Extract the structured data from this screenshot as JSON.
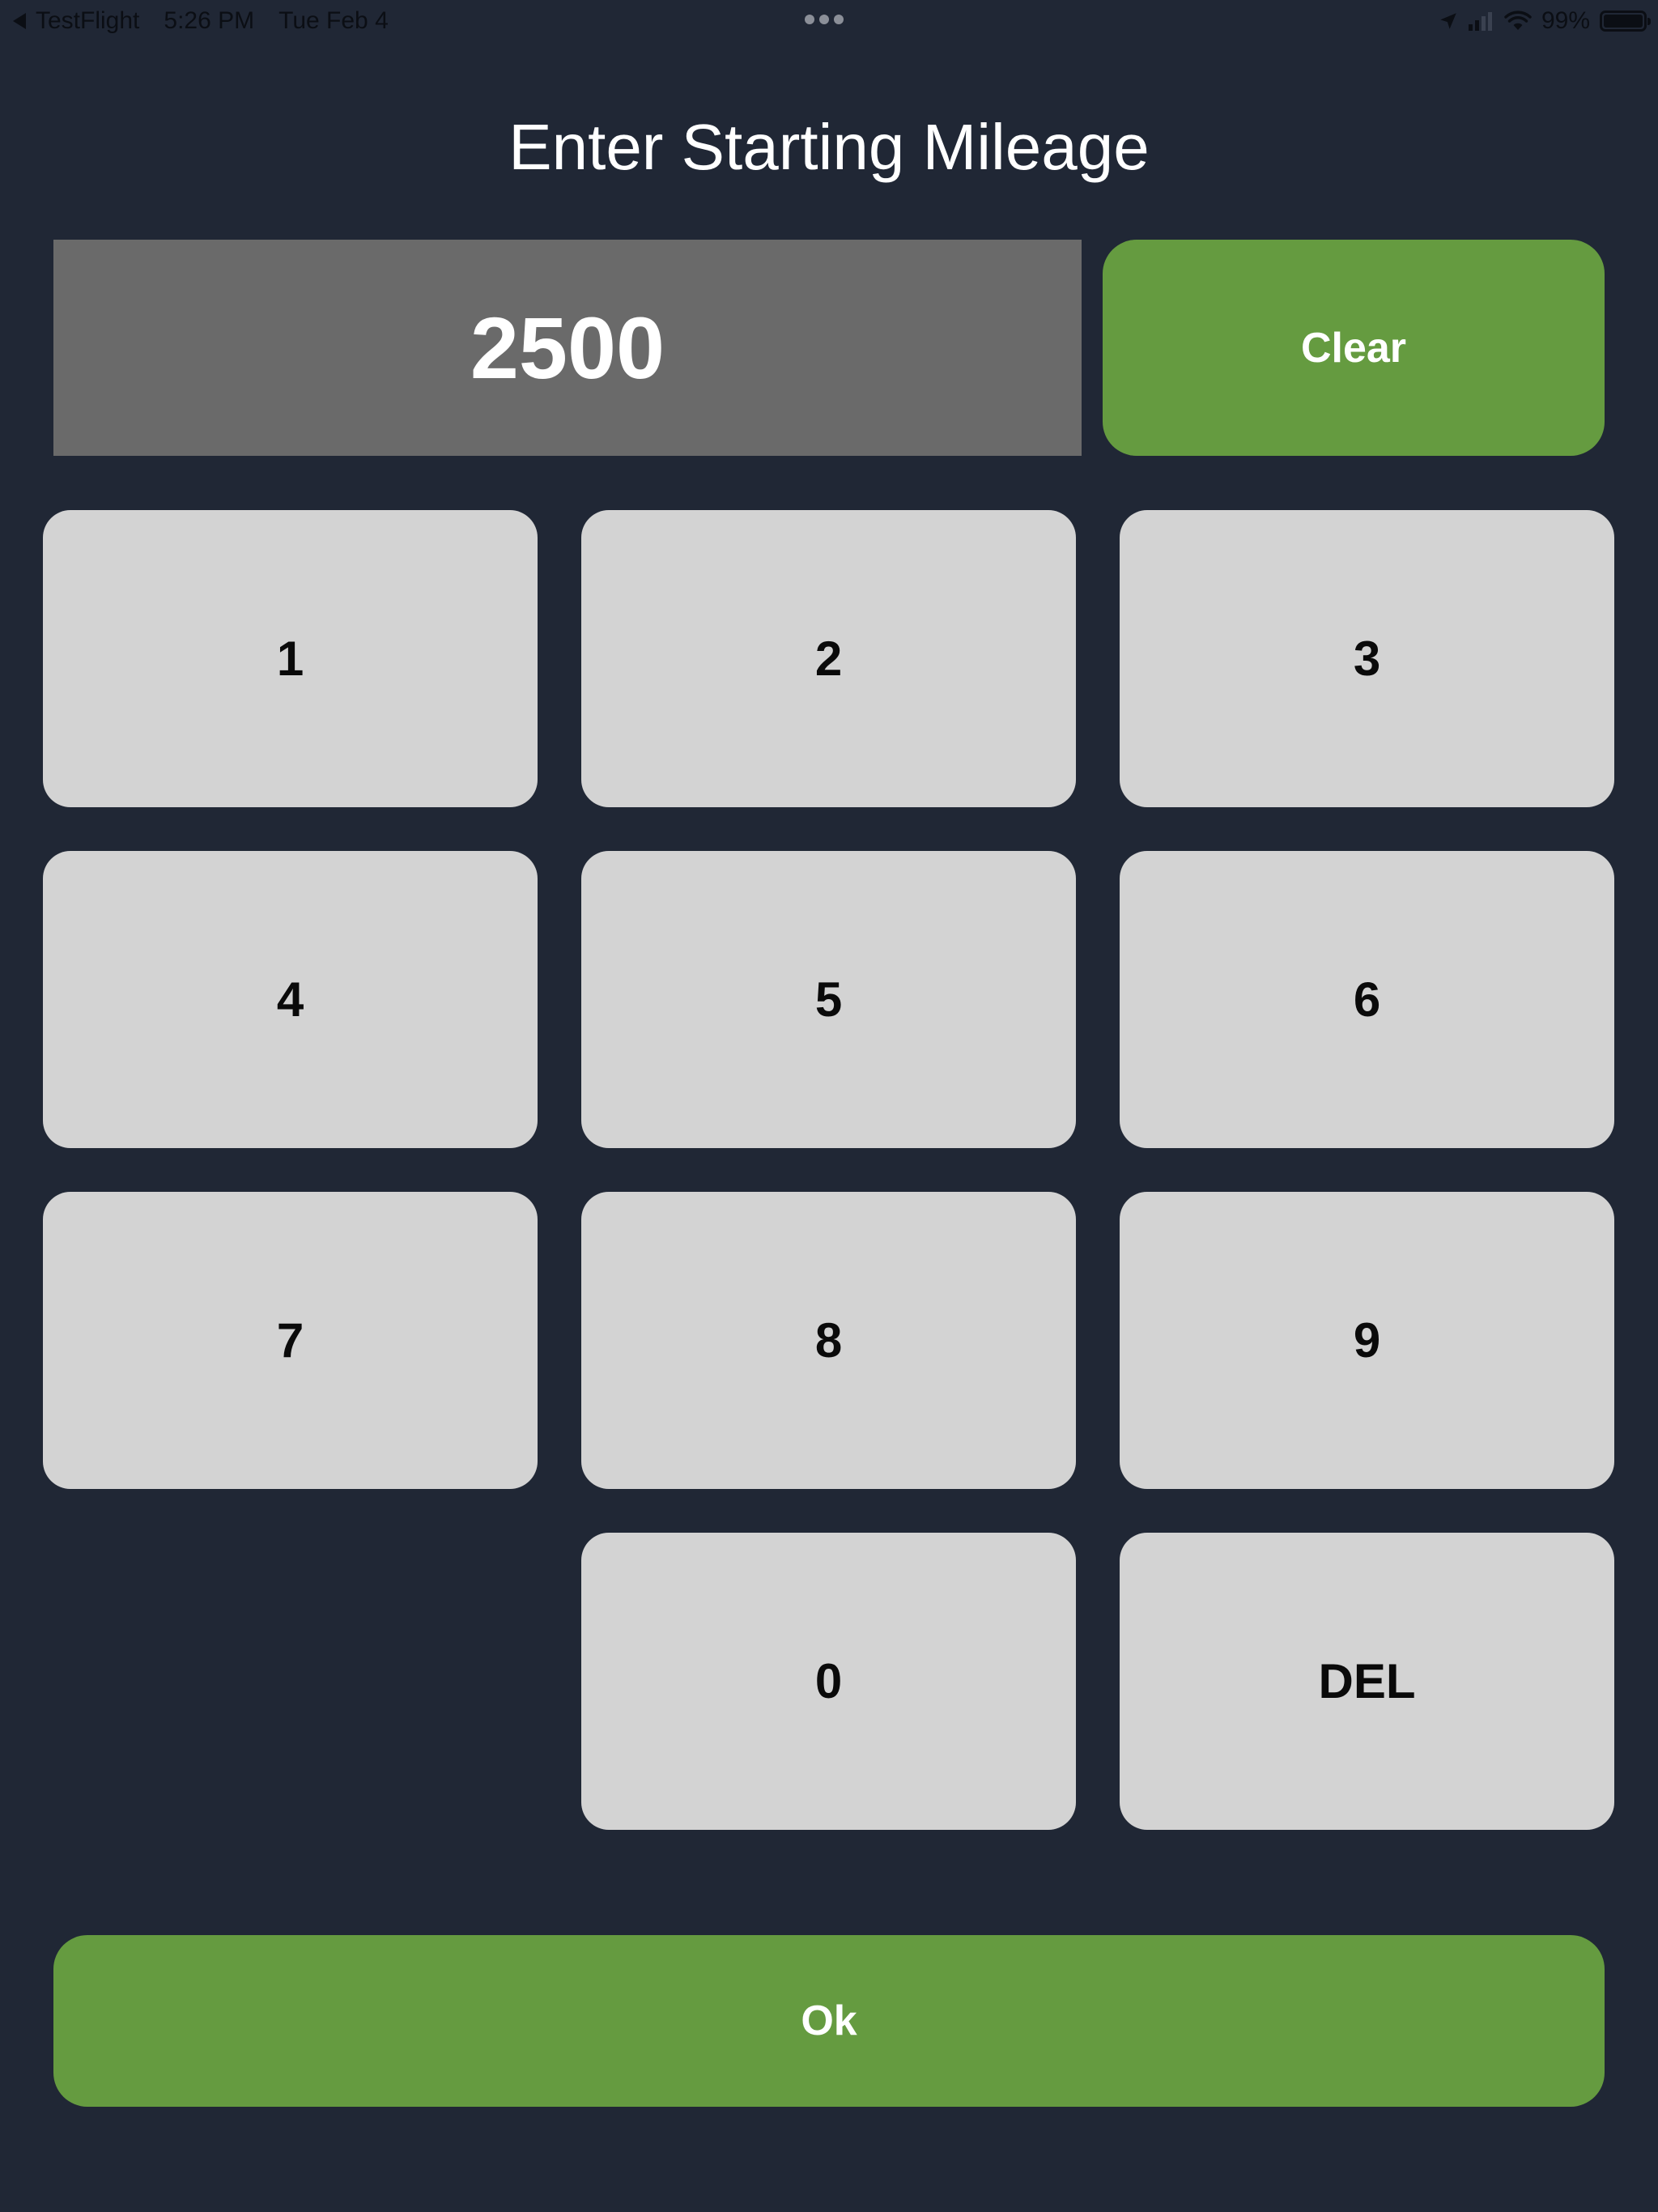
{
  "status_bar": {
    "back_app": "TestFlight",
    "time": "5:26 PM",
    "date": "Tue Feb 4",
    "battery": "99%",
    "icons": [
      "back-arrow-icon",
      "location-arrow-icon",
      "cell-signal-icon",
      "wifi-icon",
      "battery-icon"
    ]
  },
  "header": {
    "title": "Enter Starting Mileage"
  },
  "display": {
    "value": "2500"
  },
  "buttons": {
    "clear": "Clear",
    "ok": "Ok",
    "del": "DEL"
  },
  "keypad": {
    "k1": "1",
    "k2": "2",
    "k3": "3",
    "k4": "4",
    "k5": "5",
    "k6": "6",
    "k7": "7",
    "k8": "8",
    "k9": "9",
    "k0": "0"
  },
  "colors": {
    "background": "#202735",
    "display_bg": "#6a6a6a",
    "accent_green": "#659b40",
    "key_bg": "#d3d3d3"
  }
}
